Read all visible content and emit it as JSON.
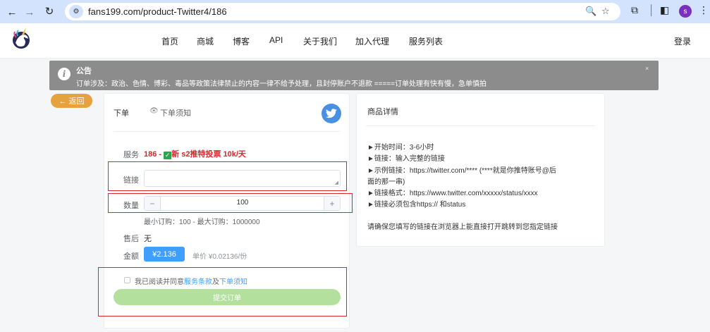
{
  "browser": {
    "url": "fans199.com/product-Twitter4/186",
    "profile_initial": "s"
  },
  "header": {
    "nav": [
      "首页",
      "商城",
      "博客",
      "API",
      "关于我们",
      "加入代理",
      "服务列表"
    ],
    "login": "登录"
  },
  "notice": {
    "title": "公告",
    "text": "订单涉及：政治、色情、博彩、毒品等政策法律禁止的内容一律不给予处理，且封停账户不退款 =====订单处理有快有慢，急单慎拍",
    "close": "×"
  },
  "back_label": "← 返回",
  "order": {
    "tab_order": "下单",
    "tab_notice": "下单须知",
    "service_label": "服务",
    "service_id": "186",
    "service_sep": "-",
    "service_new": "新",
    "service_name": "s2推特投票 10k/天",
    "link_label": "链接",
    "link_value": "",
    "qty_label": "数量",
    "qty_minus": "−",
    "qty_value": "100",
    "qty_plus": "+",
    "qty_range": "最小订购：100 - 最大订购：1000000",
    "after_label": "售后",
    "after_value": "无",
    "amount_label": "金额",
    "amount_value": "¥2.136",
    "unit_price": "单价 ¥0.02136/份",
    "agree_prefix": "我已阅读并同意",
    "agree_terms": "服务条款",
    "agree_and": "及",
    "agree_notice": "下单须知",
    "submit": "提交订单"
  },
  "details": {
    "title": "商品详情",
    "lines": [
      "►开始时间：3-6小时",
      "►链接：输入完整的链接",
      "►示例链接：https://twitter.com/**** (****就是你推特账号@后",
      "面的那一串)",
      "►链接格式：https://www.twitter.com/xxxxx/status/xxxx",
      "►链接必须包含https:// 和status"
    ],
    "note": "请确保您填写的链接在浏览器上能直接打开跳转到您指定链接"
  },
  "colors": {
    "accent": "#409eff",
    "back_button": "#e6a23c",
    "submit_disabled": "#b3e19d",
    "service_red": "#d9262b",
    "notice_bg": "#8c8c8c"
  }
}
